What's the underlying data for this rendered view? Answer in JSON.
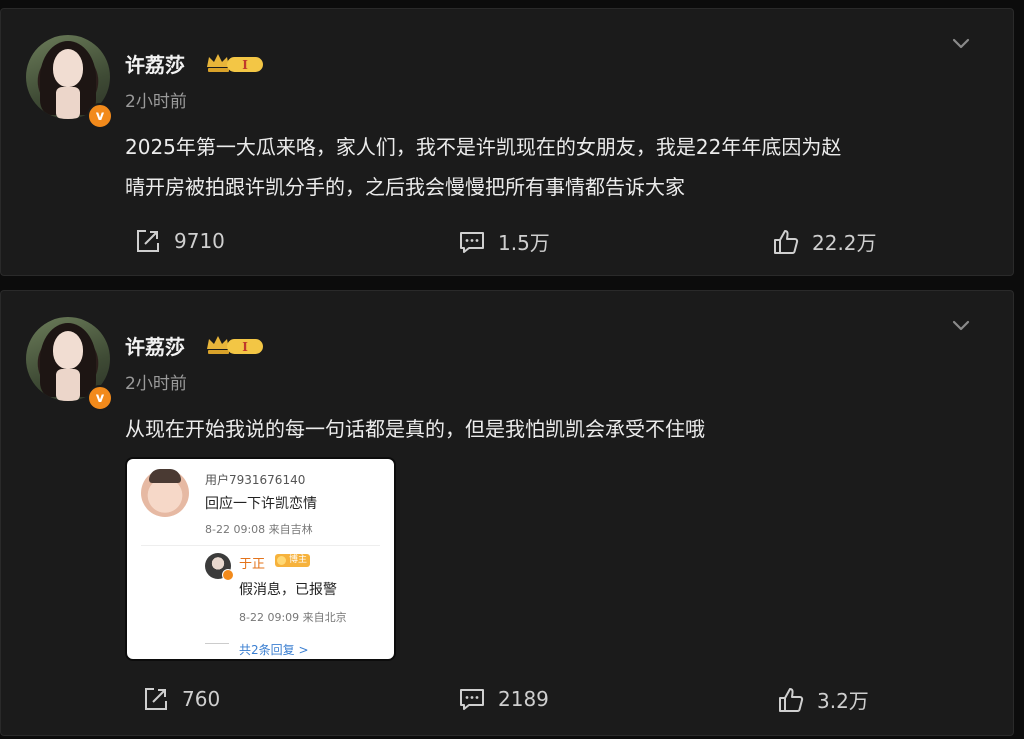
{
  "posts": [
    {
      "username": "许荔莎",
      "verified_icon": "v-badge-icon",
      "vip_level": "I",
      "time": "2小时前",
      "text": "2025年第一大瓜来咯，家人们，我不是许凯现在的女朋友，我是22年年底因为赵\n晴开房被拍跟许凯分手的，之后我会慢慢把所有事情都告诉大家",
      "repost_count": "9710",
      "comment_count": "1.5万",
      "like_count": "22.2万"
    },
    {
      "username": "许荔莎",
      "verified_icon": "v-badge-icon",
      "vip_level": "I",
      "time": "2小时前",
      "text": "从现在开始我说的每一句话都是真的，但是我怕凯凯会承受不住哦",
      "repost_count": "760",
      "comment_count": "2189",
      "like_count": "3.2万",
      "embedded_screenshot": {
        "comment_user": "用户7931676140",
        "comment_text": "回应一下许凯恋情",
        "comment_meta": "8-22 09:08 来自吉林",
        "reply_user": "于正",
        "reply_tag": "博主",
        "reply_text": "假消息，已报警",
        "reply_meta": "8-22 09:09 来自北京",
        "more_replies": "共2条回复 >"
      }
    }
  ],
  "colors": {
    "background": "#0c0c0c",
    "card": "#1b1b1b",
    "accent_orange": "#f28a1b",
    "gold": "#e8b53a"
  }
}
